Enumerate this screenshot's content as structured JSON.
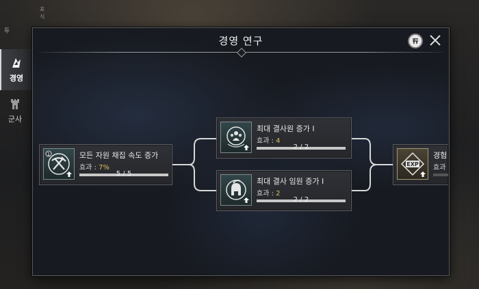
{
  "window": {
    "title": "경영 연구"
  },
  "sidebar": {
    "top_label": "투",
    "top_sub": "표식",
    "items": [
      {
        "label": "경영",
        "icon": "management-icon",
        "active": true
      },
      {
        "label": "군사",
        "icon": "castle-tower-icon",
        "active": false
      }
    ]
  },
  "research": [
    {
      "id": "gather",
      "name": "모든 자원 채집 속도 증가",
      "effect_label": "효과 :",
      "effect_value": "7%",
      "progress_text": "5 / 5",
      "progress": 1.0,
      "icon": "pickaxe-axe-icon"
    },
    {
      "id": "followers",
      "name": "최대 결사원 증가 I",
      "effect_label": "효과 :",
      "effect_value": "4",
      "progress_text": "2 / 2",
      "progress": 1.0,
      "icon": "members-icon"
    },
    {
      "id": "officers",
      "name": "최대 결사 임원 증가 I",
      "effect_label": "효과 :",
      "effect_value": "2",
      "progress_text": "2 / 2",
      "progress": 1.0,
      "icon": "spartan-helmet-icon"
    },
    {
      "id": "exp",
      "name": "경험",
      "effect_label": "효과",
      "effect_value": "",
      "progress_text": "",
      "progress": 0.0,
      "icon": "exp-icon"
    }
  ],
  "colors": {
    "accent": "#d9c25a",
    "border": "#5e5f63"
  }
}
